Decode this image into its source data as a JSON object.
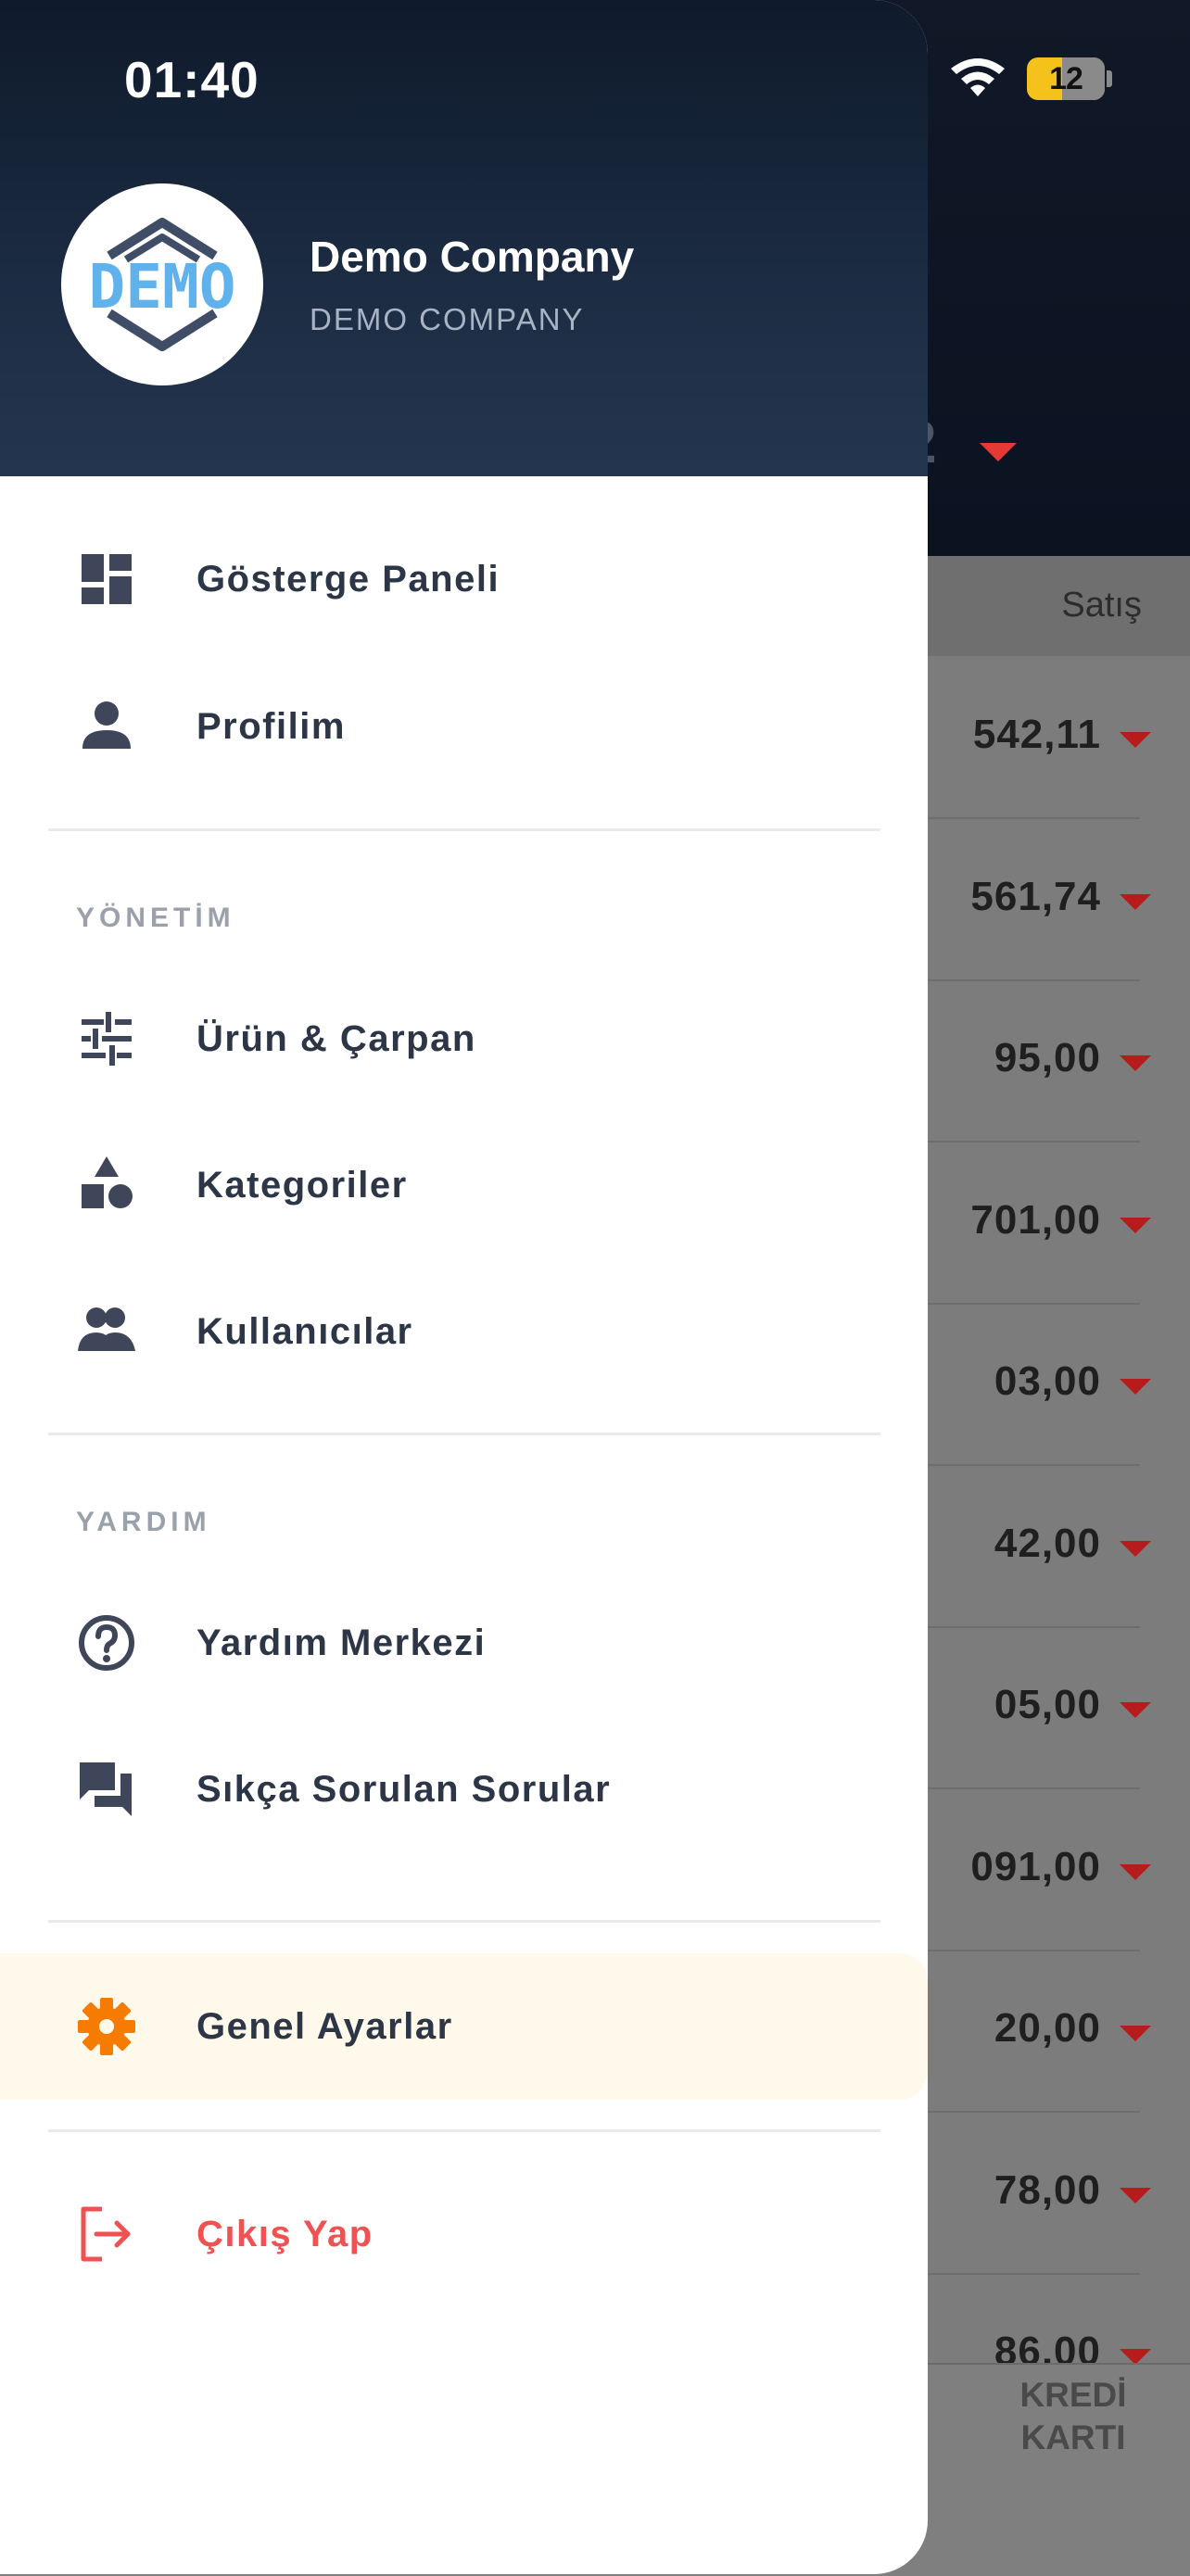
{
  "status_bar": {
    "time": "01:40",
    "battery": "12"
  },
  "background": {
    "column_header": "Satış",
    "values": [
      "542,11",
      "561,74",
      "95,00",
      "701,00",
      "03,00",
      "42,00",
      "05,00",
      "091,00",
      "20,00",
      "78,00",
      "86,00"
    ],
    "tab_label": [
      "KREDİ",
      "KARTI"
    ],
    "selector_fragment": "2"
  },
  "drawer": {
    "company_logo_text": "DEMO",
    "company_name": "Demo Company",
    "company_subtitle": "DEMO COMPANY",
    "items_main": [
      {
        "label": "Gösterge Paneli",
        "icon": "dashboard-icon"
      },
      {
        "label": "Profilim",
        "icon": "person-icon"
      }
    ],
    "section_management": "YÖNETİM",
    "items_management": [
      {
        "label": "Ürün & Çarpan",
        "icon": "sliders-icon"
      },
      {
        "label": "Kategoriler",
        "icon": "category-shapes-icon"
      },
      {
        "label": "Kullanıcılar",
        "icon": "users-icon"
      }
    ],
    "section_help": "YARDIM",
    "items_help": [
      {
        "label": "Yardım Merkezi",
        "icon": "help-circle-icon"
      },
      {
        "label": "Sıkça Sorulan Sorular",
        "icon": "chat-bubbles-icon"
      }
    ],
    "settings": {
      "label": "Genel Ayarlar",
      "icon": "gear-icon"
    },
    "logout": {
      "label": "Çıkış Yap",
      "icon": "logout-icon"
    }
  },
  "colors": {
    "header": "#1c2c43",
    "accent_orange": "#f57c00",
    "logout_red": "#f05252",
    "active_bg": "#fff9ec",
    "arrow_red": "#e53935"
  }
}
